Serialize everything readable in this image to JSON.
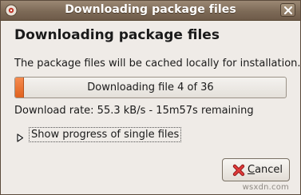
{
  "window": {
    "title": "Downloading package files"
  },
  "dialog": {
    "heading": "Downloading package files",
    "description": "The package files will be cached locally for installation.",
    "progress": {
      "fraction": 0.03,
      "text": "Downloading file 4 of 36"
    },
    "rate": "Download rate: 55.3 kB/s - 15m57s remaining",
    "expander": {
      "label": "Show progress of single files",
      "expanded": false
    },
    "cancel_button": {
      "mnemonic": "C",
      "rest": "ancel",
      "icon": "cancel-icon"
    }
  },
  "watermark": "wsxdn.com",
  "colors": {
    "titlebar": "#7d6a57",
    "progress_fill": "#e0621e",
    "cancel_icon": "#cc2222"
  }
}
